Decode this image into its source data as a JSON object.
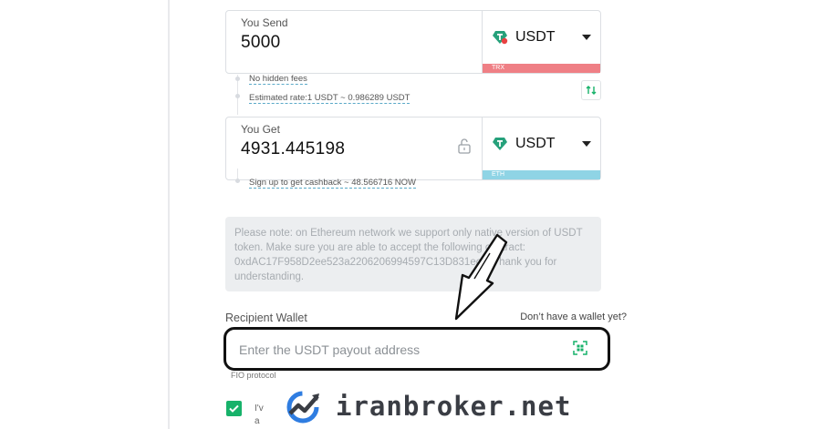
{
  "send": {
    "label": "You Send",
    "amount": "5000",
    "currency": "USDT",
    "network": "TRX"
  },
  "info": {
    "fees": "No hidden fees",
    "rate": "Estimated rate:1 USDT ~ 0.986289 USDT"
  },
  "get": {
    "label": "You Get",
    "amount": "4931.445198",
    "currency": "USDT",
    "network": "ETH"
  },
  "cashback": "Sign up to get cashback ~ 48.566716 NOW",
  "note": {
    "line1": "Please note: on Ethereum network we support only native version of USDT",
    "line2": "token. Make sure you are able to accept the following contract:",
    "line3": "0xdAC17F958D2ee523a2206206994597C13D831ec7. Thank you for",
    "line4": "understanding."
  },
  "recipient": {
    "label": "Recipient Wallet",
    "no_wallet_link": "Don’t have a wallet yet?",
    "placeholder": "Enter the USDT payout address"
  },
  "fio": "FIO protocol",
  "terms": {
    "line1": "I'v",
    "line2": "a"
  },
  "watermark": "iranbroker.net",
  "colors": {
    "accent_green": "#17b26a",
    "trx_badge": "#ef7f85",
    "eth_badge": "#8fd4e5"
  }
}
